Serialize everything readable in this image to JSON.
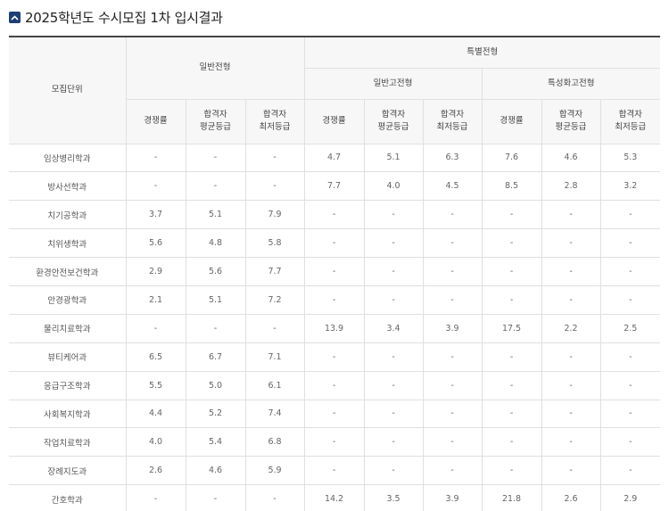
{
  "title": "2025학년도 수시모집 1차 입시결과",
  "header": {
    "unit": "모집단위",
    "general": "일반전형",
    "special": "특별전형",
    "special_general": "일반고전형",
    "special_specialized": "특성화고전형",
    "competition": "경쟁률",
    "avg_grade_l1": "합격자",
    "avg_grade_l2": "평균등급",
    "min_grade_l1": "합격자",
    "min_grade_l2": "최저등급"
  },
  "rows": [
    {
      "unit": "임상병리학과",
      "values": [
        "-",
        "-",
        "-",
        "4.7",
        "5.1",
        "6.3",
        "7.6",
        "4.6",
        "5.3"
      ]
    },
    {
      "unit": "방사선학과",
      "values": [
        "-",
        "-",
        "-",
        "7.7",
        "4.0",
        "4.5",
        "8.5",
        "2.8",
        "3.2"
      ]
    },
    {
      "unit": "치기공학과",
      "values": [
        "3.7",
        "5.1",
        "7.9",
        "-",
        "-",
        "-",
        "-",
        "-",
        "-"
      ]
    },
    {
      "unit": "치위생학과",
      "values": [
        "5.6",
        "4.8",
        "5.8",
        "-",
        "-",
        "-",
        "-",
        "-",
        "-"
      ]
    },
    {
      "unit": "환경안전보건학과",
      "values": [
        "2.9",
        "5.6",
        "7.7",
        "-",
        "-",
        "-",
        "-",
        "-",
        "-"
      ]
    },
    {
      "unit": "안경광학과",
      "values": [
        "2.1",
        "5.1",
        "7.2",
        "-",
        "-",
        "-",
        "-",
        "-",
        "-"
      ]
    },
    {
      "unit": "물리치료학과",
      "values": [
        "-",
        "-",
        "-",
        "13.9",
        "3.4",
        "3.9",
        "17.5",
        "2.2",
        "2.5"
      ]
    },
    {
      "unit": "뷰티케어과",
      "values": [
        "6.5",
        "6.7",
        "7.1",
        "-",
        "-",
        "-",
        "-",
        "-",
        "-"
      ]
    },
    {
      "unit": "응급구조학과",
      "values": [
        "5.5",
        "5.0",
        "6.1",
        "-",
        "-",
        "-",
        "-",
        "-",
        "-"
      ]
    },
    {
      "unit": "사회복지학과",
      "values": [
        "4.4",
        "5.2",
        "7.4",
        "-",
        "-",
        "-",
        "-",
        "-",
        "-"
      ]
    },
    {
      "unit": "작업치료학과",
      "values": [
        "4.0",
        "5.4",
        "6.8",
        "-",
        "-",
        "-",
        "-",
        "-",
        "-"
      ]
    },
    {
      "unit": "장례지도과",
      "values": [
        "2.6",
        "4.6",
        "5.9",
        "-",
        "-",
        "-",
        "-",
        "-",
        "-"
      ]
    },
    {
      "unit": "간호학과",
      "values": [
        "-",
        "-",
        "-",
        "14.2",
        "3.5",
        "3.9",
        "21.8",
        "2.6",
        "2.9"
      ]
    }
  ]
}
